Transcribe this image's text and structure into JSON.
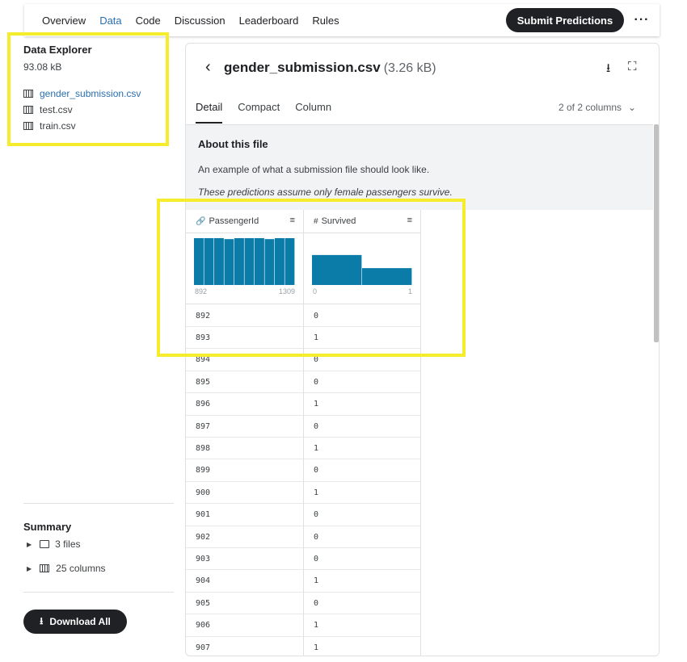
{
  "nav": {
    "tabs": [
      {
        "label": "Overview"
      },
      {
        "label": "Data"
      },
      {
        "label": "Code"
      },
      {
        "label": "Discussion"
      },
      {
        "label": "Leaderboard"
      },
      {
        "label": "Rules"
      }
    ],
    "active_tab": "Data",
    "submit_label": "Submit Predictions",
    "more_label": "···"
  },
  "sidebar": {
    "title": "Data Explorer",
    "size": "93.08 kB",
    "files": [
      {
        "name": "gender_submission.csv",
        "active": true
      },
      {
        "name": "test.csv",
        "active": false
      },
      {
        "name": "train.csv",
        "active": false
      }
    ],
    "summary_title": "Summary",
    "summary_files": "3 files",
    "summary_columns": "25 columns",
    "download_label": "Download All"
  },
  "panel": {
    "file_name": "gender_submission.csv",
    "file_size": "(3.26 kB)",
    "subtabs": [
      {
        "label": "Detail"
      },
      {
        "label": "Compact"
      },
      {
        "label": "Column"
      }
    ],
    "active_subtab": "Detail",
    "column_count": "2 of 2 columns",
    "about_title": "About this file",
    "about_desc": "An example of what a submission file should look like.",
    "about_note": "These predictions assume only female passengers survive."
  },
  "table": {
    "columns": [
      {
        "name": "PassengerId",
        "icon": "key-icon",
        "hist_min": "892",
        "hist_max": "1309",
        "hist_values": [
          1,
          1,
          1,
          0.98,
          1,
          1,
          1,
          0.98,
          1,
          1
        ]
      },
      {
        "name": "Survived",
        "icon": "hash-icon",
        "hist_min": "0",
        "hist_max": "1",
        "hist_values": [
          0.64,
          0.36
        ]
      }
    ],
    "rows": [
      [
        "892",
        "0"
      ],
      [
        "893",
        "1"
      ],
      [
        "894",
        "0"
      ],
      [
        "895",
        "0"
      ],
      [
        "896",
        "1"
      ],
      [
        "897",
        "0"
      ],
      [
        "898",
        "1"
      ],
      [
        "899",
        "0"
      ],
      [
        "900",
        "1"
      ],
      [
        "901",
        "0"
      ],
      [
        "902",
        "0"
      ],
      [
        "903",
        "0"
      ],
      [
        "904",
        "1"
      ],
      [
        "905",
        "0"
      ],
      [
        "906",
        "1"
      ],
      [
        "907",
        "1"
      ]
    ]
  },
  "colors": {
    "accent": "#2a6fb0",
    "bar": "#0b7ca8",
    "highlight": "#f5ec2b",
    "dark_button": "#202124"
  }
}
